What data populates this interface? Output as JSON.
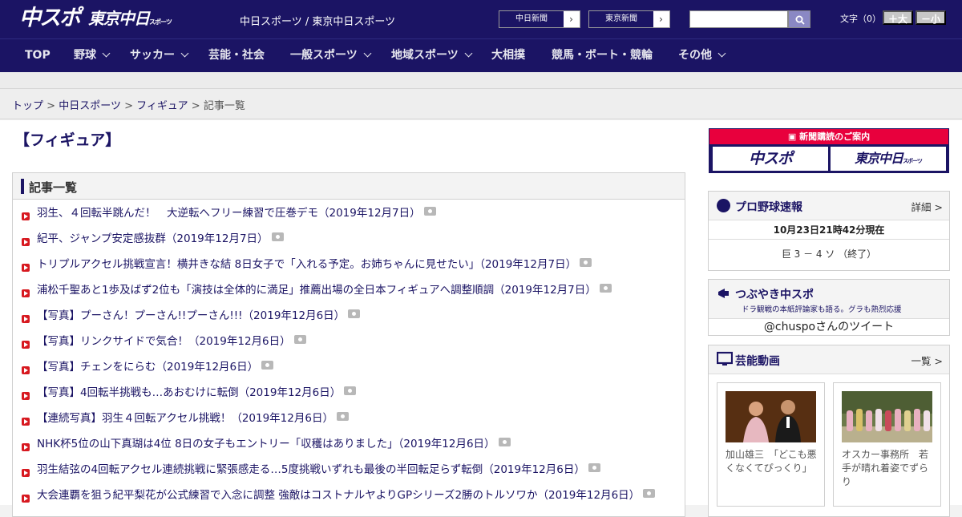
{
  "header": {
    "logo_main": "中スポ",
    "logo_tokyo": "東京中日",
    "logo_tokyo_small": "スポーツ",
    "site_names": "中日スポーツ / 東京中日スポーツ",
    "paper_buttons": [
      {
        "label": "中日新聞",
        "arrow": "›"
      },
      {
        "label": "東京新聞",
        "arrow": "›"
      }
    ],
    "search_placeholder": "",
    "font_size_label": "文字（0）",
    "font_bigger": "＋大",
    "font_smaller": "－小"
  },
  "nav": [
    {
      "label": "TOP",
      "has_menu": false
    },
    {
      "label": "野球",
      "has_menu": true
    },
    {
      "label": "サッカー",
      "has_menu": true
    },
    {
      "label": "芸能・社会",
      "has_menu": false
    },
    {
      "label": "一般スポーツ",
      "has_menu": true
    },
    {
      "label": "地域スポーツ",
      "has_menu": true
    },
    {
      "label": "大相撲",
      "has_menu": false
    },
    {
      "label": "競馬・ボート・競輪",
      "has_menu": false
    },
    {
      "label": "その他",
      "has_menu": true
    }
  ],
  "breadcrumb": {
    "items": [
      "トップ",
      "中日スポーツ",
      "フィギュア"
    ],
    "separator": ">",
    "current": "記事一覧"
  },
  "page_title": "【フィギュア】",
  "article_section": {
    "title": "記事一覧",
    "articles": [
      "羽生、４回転半跳んだ！　大逆転へフリー練習で圧巻デモ（2019年12月7日）",
      "紀平、ジャンプ安定感抜群（2019年12月7日）",
      "トリプルアクセル挑戦宣言！横井きな結 8日女子で「入れる予定。お姉ちゃんに見せたい」（2019年12月7日）",
      "浦松千聖あと1歩及ばず2位も「演技は全体的に満足」推薦出場の全日本フィギュアへ調整順調（2019年12月7日）",
      "【写真】プーさん！プーさん!!プーさん!!!（2019年12月6日）",
      "【写真】リンクサイドで気合！（2019年12月6日）",
      "【写真】チェンをにらむ（2019年12月6日）",
      "【写真】4回転半挑戦も…あおむけに転倒（2019年12月6日）",
      "【連続写真】羽生４回転アクセル挑戦！（2019年12月6日）",
      "NHK杯5位の山下真瑚は4位 8日の女子もエントリー「収穫はありました」（2019年12月6日）",
      "羽生結弦の4回転アクセル連続挑戦に緊張感走る…5度挑戦いずれも最後の半回転足らず転倒（2019年12月6日）",
      "大会連覇を狙う紀平梨花が公式練習で入念に調整 強敵はコストナルヤよりGPシリーズ2勝のトルソワか（2019年12月6日）"
    ]
  },
  "sidebar": {
    "subscription": {
      "title": "新聞購読のご案内",
      "logo_main": "中スポ",
      "logo_tokyo": "東京中日",
      "logo_tokyo_small": "スポーツ"
    },
    "baseball": {
      "title": "プロ野球速報",
      "more": "詳細 >",
      "timestamp": "10月23日21時42分現在",
      "score": "巨  3 － 4  ソ  （終了）"
    },
    "tweets": {
      "title": "つぶやき中スポ",
      "subtitle": "ドラ観戦の本紙評論家も語る。グラも熱烈応援",
      "link": "@chuspoさんのツイート"
    },
    "videos": {
      "title": "芸能動画",
      "more": "一覧 >",
      "items": [
        {
          "caption": "加山雄三　「どこも悪くなくてぴっくり」"
        },
        {
          "caption": "オスカー事務所　若手が晴れ着姿でずらり"
        }
      ]
    }
  },
  "colors": {
    "brand_navy": "#1b1464",
    "accent_red": "#d71920",
    "subscription_pink": "#e8003d"
  }
}
